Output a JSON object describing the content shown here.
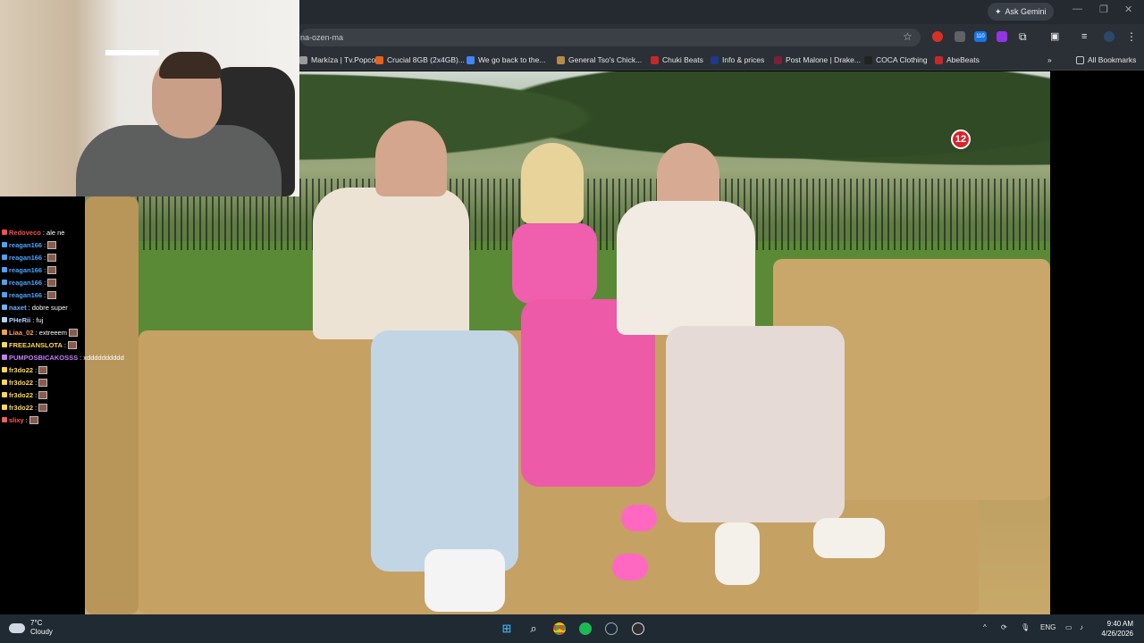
{
  "browser": {
    "ask_gemini": "Ask Gemini",
    "url": "na-ozen-ma",
    "bookmarks": [
      {
        "label": "Markíza | Tv.Popcor...",
        "color": "#9b9b9b"
      },
      {
        "label": "Crucial 8GB (2x4GB)...",
        "color": "#e8601c"
      },
      {
        "label": "We go back to the...",
        "color": "#4285f4"
      },
      {
        "label": "General Tso's Chick...",
        "color": "#b58b4a"
      },
      {
        "label": "Chuki Beats",
        "color": "#c62828"
      },
      {
        "label": "Info & prices",
        "color": "#1e3a8a"
      },
      {
        "label": "Post Malone | Drake...",
        "color": "#7b1f3a"
      },
      {
        "label": "COCA Clothing",
        "color": "#222222"
      },
      {
        "label": "AbeBeats",
        "color": "#c62828"
      }
    ],
    "all_bookmarks": "All Bookmarks",
    "extension_badge": "110"
  },
  "video": {
    "channel_badge": "12"
  },
  "chat": {
    "messages": [
      {
        "user": "Redoveco",
        "text": ": ale ne",
        "color": "#ff4d4d",
        "emote": false
      },
      {
        "user": "reagan166",
        "text": ":",
        "color": "#4aa3ff",
        "emote": true
      },
      {
        "user": "reagan166",
        "text": ":",
        "color": "#4aa3ff",
        "emote": true
      },
      {
        "user": "reagan166",
        "text": ":",
        "color": "#4aa3ff",
        "emote": true
      },
      {
        "user": "reagan166",
        "text": ":",
        "color": "#4aa3ff",
        "emote": true
      },
      {
        "user": "reagan166",
        "text": ":",
        "color": "#4aa3ff",
        "emote": true
      },
      {
        "user": "naxet",
        "text": ": dobre super",
        "color": "#6fb3ff",
        "emote": false
      },
      {
        "user": "PHeRii",
        "text": ": fuj",
        "color": "#b0d4ff",
        "emote": false
      },
      {
        "user": "Liaa_02",
        "text": ": extreeem",
        "color": "#ff9f43",
        "emote": true
      },
      {
        "user": "FREEJANSLOTA",
        "text": ":",
        "color": "#ffd84d",
        "emote": true
      },
      {
        "user": "PUMPOSBICAKOSSS",
        "text": ": xdddddddddd",
        "color": "#c77dff",
        "emote": false
      },
      {
        "user": "fr3do22",
        "text": ":",
        "color": "#ffd84d",
        "emote": true
      },
      {
        "user": "fr3do22",
        "text": ":",
        "color": "#ffd84d",
        "emote": true
      },
      {
        "user": "fr3do22",
        "text": ":",
        "color": "#ffd84d",
        "emote": true
      },
      {
        "user": "fr3do22",
        "text": ":",
        "color": "#ffd84d",
        "emote": true
      },
      {
        "user": "slixy",
        "text": ":",
        "color": "#ff5a5a",
        "emote": true
      }
    ]
  },
  "taskbar": {
    "weather_temp": "7°C",
    "weather_desc": "Cloudy",
    "lang": "ENG",
    "time": "9:40 AM",
    "date": "4/26/2026"
  }
}
